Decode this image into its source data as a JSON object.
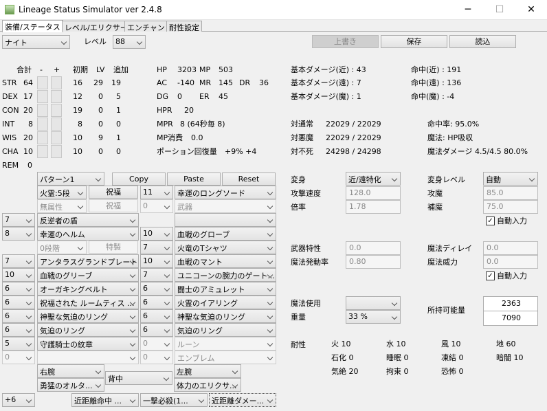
{
  "window": {
    "title": "Lineage Status Simulator ver 2.4.8",
    "minimize": "─",
    "maximize": "☐",
    "close": "✕"
  },
  "tabs": [
    "装備/ステータス",
    "レベル/エリクサー",
    "エンチャント",
    "耐性設定"
  ],
  "top": {
    "class_value": "ナイト",
    "level_label": "レベル",
    "level_value": "88",
    "overwrite": "上書き",
    "save": "保存",
    "load": "読込"
  },
  "stat_headers": {
    "total": "合計",
    "minus": "-",
    "plus": "+",
    "initial": "初期",
    "lv": "LV",
    "add": "追加"
  },
  "stats": [
    {
      "name": "STR",
      "total": "64",
      "initial": "16",
      "lv": "29",
      "add": "19"
    },
    {
      "name": "DEX",
      "total": "17",
      "initial": "12",
      "lv": "0",
      "add": "5"
    },
    {
      "name": "CON",
      "total": "20",
      "initial": "19",
      "lv": "0",
      "add": "1"
    },
    {
      "name": "INT",
      "total": "8",
      "initial": "8",
      "lv": "0",
      "add": "0"
    },
    {
      "name": "WIS",
      "total": "20",
      "initial": "10",
      "lv": "9",
      "add": "1"
    },
    {
      "name": "CHA",
      "total": "10",
      "initial": "10",
      "lv": "0",
      "add": "0"
    }
  ],
  "rem": {
    "label": "REM",
    "value": "0"
  },
  "status": {
    "hp_label": "HP",
    "hp": "3203",
    "mp_label": "MP",
    "mp": "503",
    "ac_label": "AC",
    "ac": "-140",
    "mr_label": "MR",
    "mr": "145",
    "dr_label": "DR",
    "dr": "36",
    "dg_label": "DG",
    "dg": "0",
    "er_label": "ER",
    "er": "45",
    "hpr_label": "HPR",
    "hpr": "20",
    "mpr_label": "MPR",
    "mpr": "8 (64秒毎 8)",
    "mp_cost_label": "MP消費",
    "mp_cost": "0.0",
    "potion_label": "ポーション回復量",
    "potion": "+9%  +4"
  },
  "damage": {
    "near": "基本ダメージ(近) : 43",
    "far": "基本ダメージ(遠) : 7",
    "magic": "基本ダメージ(魔) : 1",
    "hit_near": "命中(近) : 191",
    "hit_far": "命中(遠) : 136",
    "hit_magic": "命中(魔) : -4"
  },
  "vs": {
    "normal_label": "対通常",
    "normal": "22029 / 22029",
    "evil_label": "対悪魔",
    "evil": "22029 / 22029",
    "undead_label": "対不死",
    "undead": "24298 / 24298",
    "hit_rate": "命中率: 95.0%",
    "magic": "魔法: HP吸収",
    "magic_damage": "魔法ダメージ 4.5/4.5  80.0%"
  },
  "equip": {
    "pattern": "パターン1",
    "copy": "Copy",
    "paste": "Paste",
    "reset": "Reset",
    "rows": [
      {
        "enchant": "",
        "item_a": "火霊:5段",
        "item_b": "祝福",
        "num": "11",
        "name": "幸運のロングソード"
      },
      {
        "enchant": "",
        "item_a": "無属性",
        "item_b": "祝福",
        "num": "0",
        "name": "武器"
      },
      {
        "enchant": "7",
        "name_left": "反逆者の盾"
      },
      {
        "enchant": "8",
        "name_left": "幸運のヘルム",
        "num": "10",
        "name": "血戦のグローブ"
      },
      {
        "item_a": "0段階",
        "item_b": "特製",
        "num": "7",
        "name": "火竜のTシャツ"
      },
      {
        "enchant": "7",
        "name_left": "アンタラスグランドプレート...",
        "num": "10",
        "name": "血戦のマント"
      },
      {
        "enchant": "10",
        "name_left": "血戦のグリーブ",
        "num": "7",
        "name": "ユニコーンの腕力のゲート..."
      },
      {
        "enchant": "6",
        "name_left": "オーガキングベルト",
        "num": "6",
        "name": "闘士のアミュレット"
      },
      {
        "enchant": "6",
        "name_left": "祝福された ルームティス ...",
        "num": "6",
        "name": "火霊のイアリング"
      },
      {
        "enchant": "6",
        "name_left": "神聖な気迫のリング",
        "num": "6",
        "name": "神聖な気迫のリング"
      },
      {
        "enchant": "6",
        "name_left": "気迫のリング",
        "num": "6",
        "name": "気迫のリング"
      },
      {
        "enchant": "5",
        "name_left": "守護騎士の紋章",
        "num": "0",
        "name": "ルーン"
      },
      {
        "enchant": "0",
        "name_left": "",
        "num": "0",
        "name": "エンブレム"
      }
    ],
    "right_arm_label": "右腕",
    "right_arm": "勇猛のオルタ...",
    "back": "背中",
    "left_arm_label": "左腕",
    "left_arm": "体力のエリクサ...",
    "bottom": [
      "+6",
      "近距離命中 ...",
      "一撃必殺(1...",
      "近距離ダメー..."
    ]
  },
  "transform": {
    "label": "変身",
    "value": "近/遠特化",
    "level_label": "変身レベル",
    "level_value": "自動",
    "attack_speed_label": "攻撃速度",
    "attack_speed": "128.0",
    "attack_magic_label": "攻魔",
    "attack_magic": "85.0",
    "ratio_label": "倍率",
    "ratio": "1.78",
    "support_magic_label": "補魔",
    "support_magic": "75.0",
    "auto": "自動入力"
  },
  "weapon": {
    "trait_label": "武器特性",
    "trait": "0.0",
    "delay_label": "魔法ディレイ",
    "delay": "0.0",
    "spell_rate_label": "魔法発動率",
    "spell_rate": "0.80",
    "power_label": "魔法威力",
    "power": "0.0",
    "auto": "自動入力"
  },
  "magic_use": {
    "label": "魔法使用",
    "value": "",
    "weight_label": "重量",
    "weight_value": "33 %",
    "capacity_label": "所持可能量",
    "current": "2363",
    "max": "7090"
  },
  "resist": {
    "label": "耐性",
    "items": [
      {
        "k": "火",
        "v": "10"
      },
      {
        "k": "水",
        "v": "10"
      },
      {
        "k": "風",
        "v": "10"
      },
      {
        "k": "地",
        "v": "60"
      },
      {
        "k": "石化",
        "v": "0"
      },
      {
        "k": "睡眠",
        "v": "0"
      },
      {
        "k": "凍結",
        "v": "0"
      },
      {
        "k": "暗闇",
        "v": "10"
      },
      {
        "k": "気絶",
        "v": "20"
      },
      {
        "k": "拘束",
        "v": "0"
      },
      {
        "k": "恐怖",
        "v": "0"
      }
    ]
  },
  "colors": {
    "disabled_text": "#8d8d8d",
    "accent": "#ffffff"
  }
}
